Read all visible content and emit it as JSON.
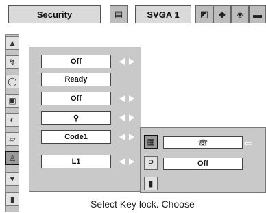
{
  "header": {
    "title": "Security",
    "resolution": "SVGA 1"
  },
  "sidebar": {
    "icons": [
      "up-arrow-icon",
      "input-icon",
      "display-icon",
      "image-icon",
      "sound-icon",
      "setting-icon",
      "security-icon",
      "down-arrow-icon",
      "exit-icon"
    ]
  },
  "security_items": [
    {
      "value": "Off"
    },
    {
      "value": "Ready"
    },
    {
      "value": "Off"
    },
    {
      "value": ""
    },
    {
      "value": "Code1"
    },
    {
      "value": "L1"
    }
  ],
  "submenu": {
    "items": [
      {
        "icon": "lock-icon",
        "value": ""
      },
      {
        "icon": "pin-code-icon",
        "value": "Off"
      },
      {
        "icon": "exit-icon",
        "value": ""
      }
    ]
  },
  "footer": {
    "text": "Select Key lock.  Choose"
  }
}
